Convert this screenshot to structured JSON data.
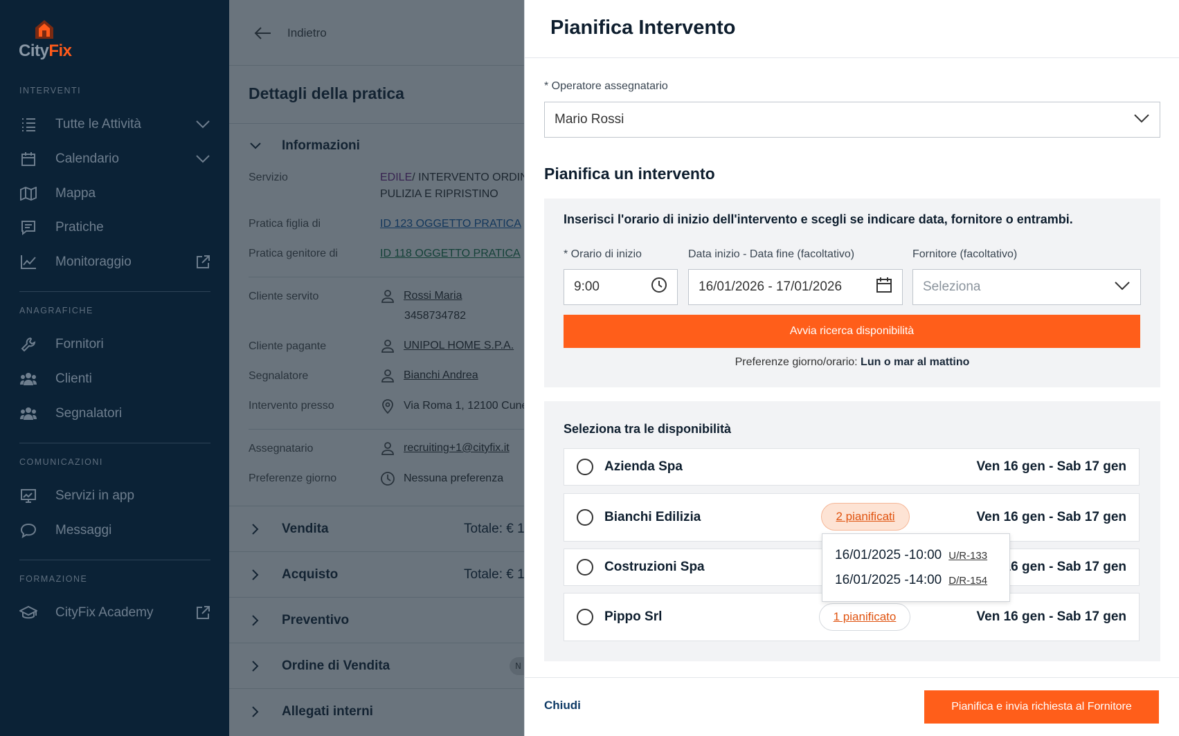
{
  "sidebar": {
    "logo": {
      "part1": "City",
      "part2": "Fix"
    },
    "sections": {
      "interventi": "INTERVENTI",
      "anagrafiche": "ANAGRAFICHE",
      "comunicazioni": "COMUNICAZIONI",
      "formazione": "FORMAZIONE"
    },
    "items": {
      "tutte": "Tutte le Attività",
      "calendario": "Calendario",
      "mappa": "Mappa",
      "pratiche": "Pratiche",
      "monitoraggio": "Monitoraggio",
      "fornitori": "Fornitori",
      "clienti": "Clienti",
      "segnalatori": "Segnalatori",
      "servizi": "Servizi in app",
      "messaggi": "Messaggi",
      "academy": "CityFix Academy"
    }
  },
  "page": {
    "back": "Indietro",
    "title": "Dettagli della pratica",
    "info_section": "Informazioni",
    "fields": {
      "servizio_label": "Servizio",
      "servizio_cat": "EDILE",
      "servizio_value": " / INTERVENTO ORDINARIO",
      "servizio_value2": "PULIZIA E RIPRISTINO",
      "figlia_label": "Pratica figlia di",
      "figlia_value": "ID 123 OGGETTO PRATICA",
      "genitore_label": "Pratica genitore di",
      "genitore_value": "ID 118 OGGETTO PRATICA",
      "cliente_servito_label": "Cliente servito",
      "cliente_servito_value": "Rossi Maria",
      "cliente_servito_phone": "3458734782",
      "cliente_pagante_label": "Cliente pagante",
      "cliente_pagante_value": "UNIPOL HOME S.P.A.",
      "segnalatore_label": "Segnalatore",
      "segnalatore_value": "Bianchi Andrea",
      "intervento_label": "Intervento presso",
      "intervento_value": "Via Roma 1, 12100 Cuneo",
      "assegnatario_label": "Assegnatario",
      "assegnatario_value": "recruiting+1@cityfix.it",
      "preferenze_label": "Preferenze giorno",
      "preferenze_value": "Nessuna preferenza"
    },
    "sections": {
      "vendita": "Vendita",
      "vendita_totale": "Totale: € 1",
      "acquisto": "Acquisto",
      "acquisto_totale": "Totale: € 1",
      "preventivo": "Preventivo",
      "ordine": "Ordine di Vendita",
      "ordine_badge": "N",
      "allegati": "Allegati interni"
    }
  },
  "drawer": {
    "title": "Pianifica Intervento",
    "operatore_label": "* Operatore assegnatario",
    "operatore_value": "Mario Rossi",
    "section_title": "Pianifica un intervento",
    "instructions": "Inserisci l'orario di inizio dell'intervento e scegli se indicare data, fornitore o entrambi.",
    "orario_label": "* Orario di inizio",
    "orario_value": "9:00",
    "data_label": "Data inizio - Data fine (facoltativo)",
    "data_value": "16/01/2026 - 17/01/2026",
    "fornitore_label": "Fornitore (facoltativo)",
    "fornitore_placeholder": "Seleziona",
    "search_button": "Avvia ricerca disponibilità",
    "pref_label": "Preferenze giorno/orario: ",
    "pref_value": "Lun o mar al mattino",
    "availability_title": "Seleziona tra le disponibilità",
    "options": [
      {
        "name": "Azienda Spa",
        "dates": "Ven 16 gen - Sab 17 gen"
      },
      {
        "name": "Bianchi Edilizia",
        "dates": "Ven 16 gen - Sab 17 gen",
        "badge": "2 pianificati"
      },
      {
        "name": "Costruzioni Spa",
        "dates": "Ven 16 gen - Sab 17 gen"
      },
      {
        "name": "Pippo Srl",
        "dates": "Ven 16 gen - Sab 17 gen",
        "badge": "1 pianificato"
      }
    ],
    "tooltip": [
      {
        "time": "16/01/2025 -10:00",
        "code": "U/R-133"
      },
      {
        "time": "16/01/2025 -14:00",
        "code": "D/R-154"
      }
    ],
    "close_button": "Chiudi",
    "submit_button": "Pianifica e invia richiesta al Fornitore"
  },
  "colors": {
    "sidebar_bg": "#0b2236",
    "accent": "#ff5e1a",
    "link": "#1b5fa8"
  }
}
